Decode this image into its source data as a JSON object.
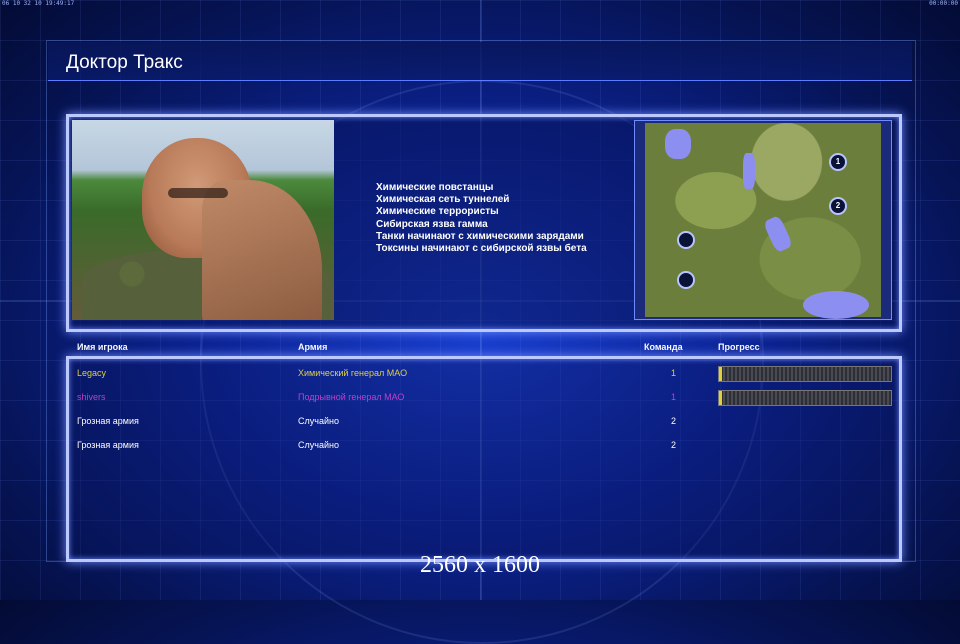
{
  "statusbar": {
    "left": "06 10 32 10 19:49:17",
    "right": "00:00:00"
  },
  "title": "Доктор Тракс",
  "description": [
    "Химические повстанцы",
    "Химическая сеть туннелей",
    "Химические террористы",
    "Сибирская язва гамма",
    "Танки начинают с химическими зарядами",
    "Токсины начинают с сибирской язвы бета"
  ],
  "minimap": {
    "spawns": [
      {
        "label": "1"
      },
      {
        "label": "2"
      },
      {
        "label": ""
      },
      {
        "label": ""
      }
    ]
  },
  "table": {
    "headers": {
      "name": "Имя игрока",
      "army": "Армия",
      "team": "Команда",
      "progress": "Прогресс"
    },
    "rows": [
      {
        "name": "Legacy",
        "army": "Химический генерал МАО",
        "team": "1",
        "color": "#e0d040",
        "progress": 0.01
      },
      {
        "name": "shivers",
        "army": "Подрывной генерал МАО",
        "team": "1",
        "color": "#c040c8",
        "progress": 0.0
      },
      {
        "name": "Грозная армия",
        "army": "Случайно",
        "team": "2",
        "color": "#ffffff"
      },
      {
        "name": "Грозная армия",
        "army": "Случайно",
        "team": "2",
        "color": "#ffffff"
      }
    ]
  },
  "resolution": "2560 x 1600",
  "colors": {
    "accent": "#bcc9ff",
    "background": "#0c2394"
  }
}
